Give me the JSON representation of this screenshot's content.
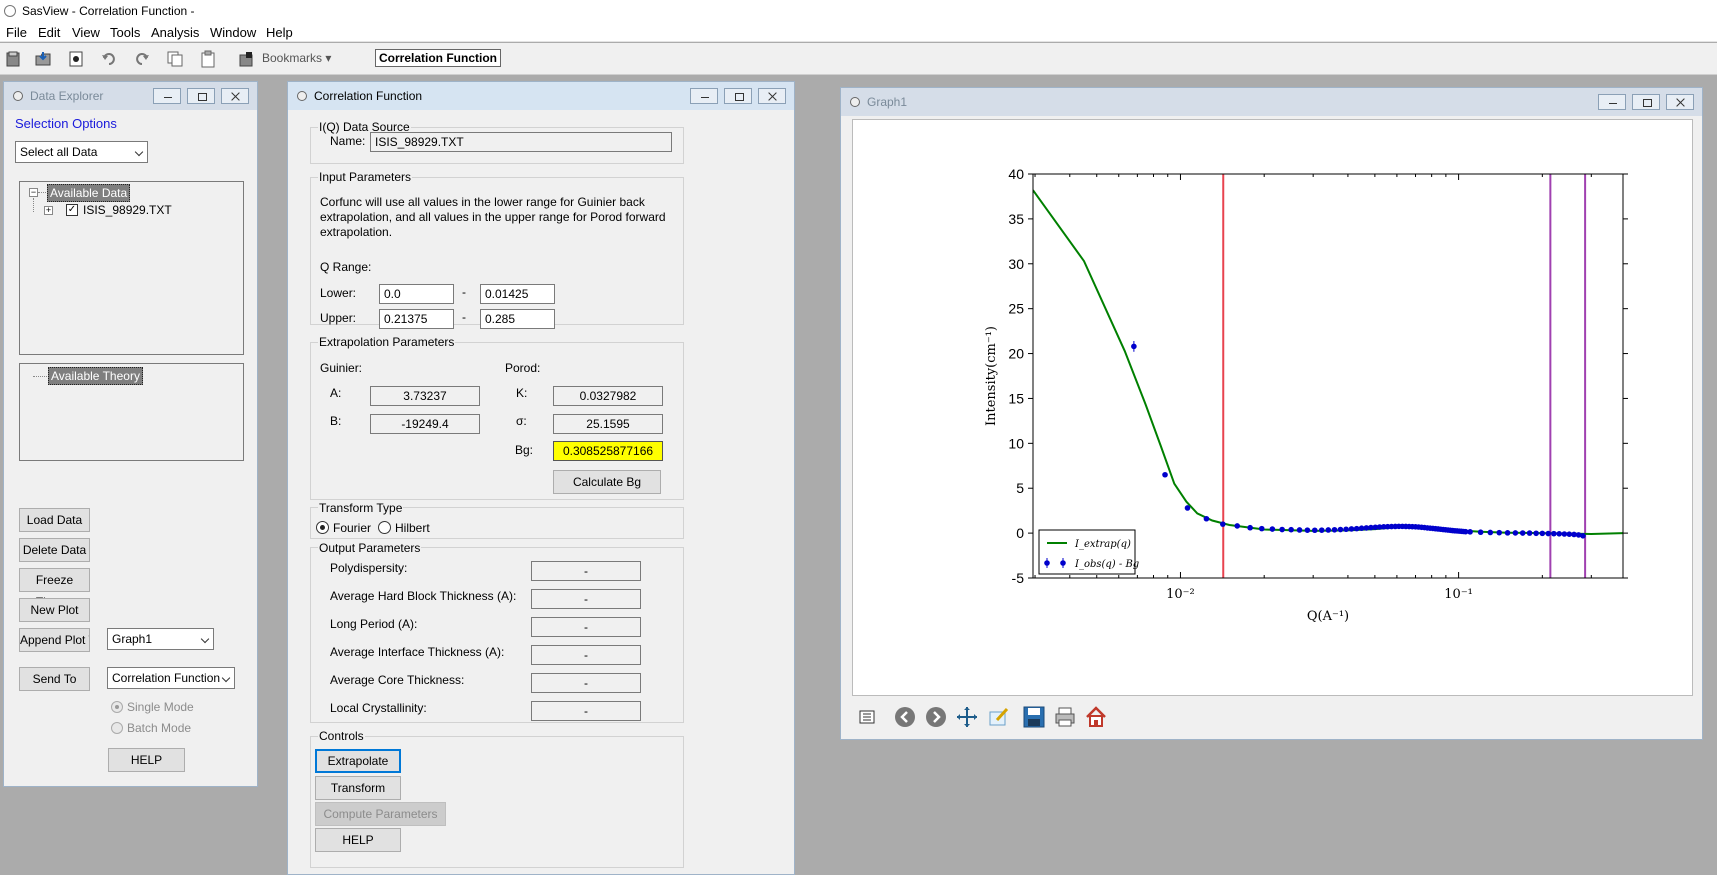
{
  "app": {
    "title": "SasView  - Correlation Function -"
  },
  "menu": [
    "File",
    "Edit",
    "View",
    "Tools",
    "Analysis",
    "Window",
    "Help"
  ],
  "toolbar": {
    "bookmarks_label": "Bookmarks",
    "active_perspective": "Correlation Function",
    "icons": [
      "open-file-icon",
      "open-folder-icon",
      "save-icon",
      "undo-icon",
      "redo-icon",
      "copy-icon",
      "paste-icon",
      "bookmark-icon"
    ]
  },
  "data_explorer": {
    "title": "Data Explorer",
    "selection_options": "Selection Options",
    "select_combo": "Select all Data",
    "available_data": "Available Data",
    "data_item": "ISIS_98929.TXT",
    "available_theory": "Available Theory",
    "load_data": "Load Data",
    "delete_data": "Delete Data",
    "freeze_theory": "Freeze Theory",
    "new_plot": "New Plot",
    "append_plot": "Append Plot To",
    "append_combo": "Graph1",
    "send_to": "Send To",
    "send_combo": "Correlation Function",
    "single_mode": "Single Mode",
    "batch_mode": "Batch Mode",
    "help": "HELP"
  },
  "corfunc": {
    "title": "Correlation Function",
    "source_group": "I(Q) Data Source",
    "name_label": "Name:",
    "name_value": "ISIS_98929.TXT",
    "input_group": "Input Parameters",
    "input_desc_1": "Corfunc will use all values in the lower range for Guinier back",
    "input_desc_2": "extrapolation, and all values in the upper range for Porod forward",
    "input_desc_3": "extrapolation.",
    "q_range": "Q Range:",
    "lower_label": "Lower:",
    "lower_min": "0.0",
    "lower_max": "0.01425",
    "upper_label": "Upper:",
    "upper_min": "0.21375",
    "upper_max": "0.285",
    "dash": "-",
    "extrap_group": "Extrapolation Parameters",
    "guinier": "Guinier:",
    "porod": "Porod:",
    "a_label": "A:",
    "a_value": "3.73237",
    "b_label": "B:",
    "b_value": "-19249.4",
    "k_label": "K:",
    "k_value": "0.0327982",
    "sigma_label": "σ:",
    "sigma_value": "25.1595",
    "bg_label": "Bg:",
    "bg_value": "0.308525877166",
    "calc_bg": "Calculate Bg",
    "transform_group": "Transform Type",
    "fourier": "Fourier",
    "hilbert": "Hilbert",
    "output_group": "Output Parameters",
    "outputs": [
      {
        "label": "Polydispersity:",
        "value": "-"
      },
      {
        "label": "Average Hard Block Thickness (A):",
        "value": "-"
      },
      {
        "label": "Long Period (A):",
        "value": "-"
      },
      {
        "label": "Average Interface Thickness (A):",
        "value": "-"
      },
      {
        "label": "Average Core Thickness:",
        "value": "-"
      },
      {
        "label": "Local Crystallinity:",
        "value": "-"
      }
    ],
    "controls_group": "Controls",
    "extrapolate": "Extrapolate",
    "transform": "Transform",
    "compute": "Compute Parameters",
    "help": "HELP"
  },
  "graph": {
    "title": "Graph1",
    "icons": [
      "list-icon",
      "back-arrow-icon",
      "forward-arrow-icon",
      "pan-icon",
      "edit-icon",
      "save-disk-icon",
      "print-icon",
      "home-icon"
    ]
  },
  "chart_data": {
    "type": "line",
    "xlabel": "Q(A⁻¹)",
    "ylabel": "Intensity(cm⁻¹)",
    "xscale": "log",
    "xlim": [
      0.00295,
      0.39
    ],
    "ylim": [
      -5,
      40
    ],
    "yticks": [
      -5,
      0,
      5,
      10,
      15,
      20,
      25,
      30,
      35,
      40
    ],
    "xticks": [
      {
        "value": 0.01,
        "label": "10⁻²"
      },
      {
        "value": 0.1,
        "label": "10⁻¹"
      }
    ],
    "legend_position": "lower-left",
    "series": [
      {
        "name": "I_extrap(q)",
        "style": "line",
        "color": "#008000",
        "x": [
          0.00295,
          0.0045,
          0.0063,
          0.0075,
          0.0085,
          0.0095,
          0.0105,
          0.0115,
          0.013,
          0.015,
          0.02,
          0.03,
          0.04,
          0.05,
          0.06,
          0.07,
          0.08,
          0.09,
          0.1,
          0.12,
          0.15,
          0.2,
          0.25,
          0.3,
          0.39
        ],
        "y": [
          38.2,
          30.3,
          20.3,
          14.3,
          9.7,
          5.5,
          3.5,
          2.2,
          1.4,
          0.9,
          0.4,
          0.25,
          0.3,
          0.45,
          0.65,
          0.75,
          0.65,
          0.45,
          0.3,
          0.15,
          0.05,
          0.0,
          -0.05,
          -0.1,
          0.0
        ]
      },
      {
        "name": "I_obs(q) - Bg",
        "style": "errorbar",
        "color": "#0000cc",
        "x": [
          0.0068,
          0.0088,
          0.0106,
          0.0124,
          0.0142,
          0.016,
          0.0178,
          0.0196,
          0.0214,
          0.0232,
          0.025,
          0.0268,
          0.0286,
          0.0304,
          0.0322,
          0.034,
          0.0358,
          0.0376,
          0.0394,
          0.0412,
          0.043,
          0.0448,
          0.0466,
          0.0484,
          0.0502,
          0.052,
          0.0538,
          0.0556,
          0.0574,
          0.0592,
          0.061,
          0.0628,
          0.0646,
          0.0664,
          0.0682,
          0.07,
          0.0718,
          0.0736,
          0.0754,
          0.0772,
          0.079,
          0.0808,
          0.0826,
          0.0844,
          0.0862,
          0.088,
          0.0898,
          0.0916,
          0.0934,
          0.0952,
          0.097,
          0.0988,
          0.1006,
          0.1024,
          0.1042,
          0.106,
          0.11,
          0.12,
          0.13,
          0.14,
          0.15,
          0.16,
          0.17,
          0.18,
          0.19,
          0.2,
          0.21,
          0.22,
          0.23,
          0.24,
          0.25,
          0.26,
          0.27,
          0.28
        ],
        "y": [
          20.8,
          6.5,
          2.8,
          1.6,
          1.0,
          0.8,
          0.6,
          0.5,
          0.45,
          0.4,
          0.38,
          0.35,
          0.33,
          0.32,
          0.33,
          0.35,
          0.37,
          0.4,
          0.43,
          0.47,
          0.5,
          0.55,
          0.58,
          0.62,
          0.65,
          0.68,
          0.7,
          0.72,
          0.73,
          0.74,
          0.75,
          0.75,
          0.74,
          0.73,
          0.72,
          0.7,
          0.68,
          0.65,
          0.62,
          0.58,
          0.55,
          0.52,
          0.49,
          0.46,
          0.43,
          0.4,
          0.37,
          0.34,
          0.31,
          0.28,
          0.26,
          0.24,
          0.22,
          0.2,
          0.18,
          0.16,
          0.14,
          0.1,
          0.07,
          0.05,
          0.03,
          0.02,
          0.01,
          0.0,
          -0.02,
          -0.03,
          -0.05,
          -0.06,
          -0.08,
          -0.1,
          -0.12,
          -0.15,
          -0.2,
          -0.3
        ],
        "errors": [
          0.6,
          0.2,
          0.1,
          0.08,
          0.06,
          0.05,
          0.05,
          0.05,
          0.05,
          0.05,
          0.05,
          0.05,
          0.05,
          0.05,
          0.05,
          0.05,
          0.05,
          0.05,
          0.05,
          0.05,
          0.05,
          0.05,
          0.05,
          0.05,
          0.05,
          0.05,
          0.05,
          0.05,
          0.05,
          0.05,
          0.05,
          0.05,
          0.05,
          0.05,
          0.05,
          0.05,
          0.05,
          0.05,
          0.05,
          0.05,
          0.05,
          0.05,
          0.05,
          0.05,
          0.05,
          0.05,
          0.05,
          0.05,
          0.05,
          0.05,
          0.05,
          0.05,
          0.05,
          0.05,
          0.05,
          0.05,
          0.06,
          0.06,
          0.06,
          0.07,
          0.07,
          0.08,
          0.08,
          0.09,
          0.1,
          0.1,
          0.12,
          0.12,
          0.14,
          0.16,
          0.18,
          0.2,
          0.25,
          0.3
        ]
      }
    ],
    "vlines": [
      {
        "x": 0.01425,
        "color": "#e8434f"
      },
      {
        "x": 0.21375,
        "color": "#a040b0"
      },
      {
        "x": 0.285,
        "color": "#a040b0"
      }
    ]
  }
}
